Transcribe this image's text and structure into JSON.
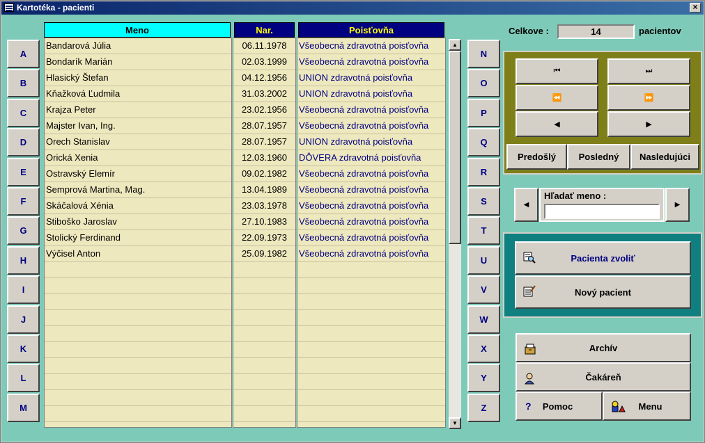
{
  "window": {
    "title": "Kartotéka - pacienti",
    "close": "×"
  },
  "letters_left": [
    "A",
    "B",
    "C",
    "D",
    "E",
    "F",
    "G",
    "H",
    "I",
    "J",
    "K",
    "L",
    "M"
  ],
  "letters_right": [
    "N",
    "O",
    "P",
    "Q",
    "R",
    "S",
    "T",
    "U",
    "V",
    "W",
    "X",
    "Y",
    "Z"
  ],
  "table": {
    "headers": {
      "name": "Meno",
      "date": "Nar.",
      "insurer": "Poisťovňa"
    },
    "header_colors": {
      "name_bg": "#00ffff",
      "other_bg": "#000080",
      "other_fg": "#ffff00"
    },
    "rows": [
      {
        "name": "Bandarová Júlia",
        "date": "06.11.1978",
        "insurer": "Všeobecná zdravotná poisťovňa"
      },
      {
        "name": "Bondarík Marián",
        "date": "02.03.1999",
        "insurer": "Všeobecná zdravotná poisťovňa"
      },
      {
        "name": "Hlasický Štefan",
        "date": "04.12.1956",
        "insurer": "UNION zdravotná poisťovňa"
      },
      {
        "name": "Kňažková Ľudmila",
        "date": "31.03.2002",
        "insurer": "UNION zdravotná poisťovňa"
      },
      {
        "name": "Krajza Peter",
        "date": "23.02.1956",
        "insurer": "Všeobecná zdravotná poisťovňa"
      },
      {
        "name": "Majster Ivan, Ing.",
        "date": "28.07.1957",
        "insurer": "Všeobecná zdravotná poisťovňa"
      },
      {
        "name": "Orech Stanislav",
        "date": "28.07.1957",
        "insurer": "UNION zdravotná poisťovňa"
      },
      {
        "name": "Orická Xenia",
        "date": "12.03.1960",
        "insurer": "DÔVERA zdravotná poisťovňa"
      },
      {
        "name": "Ostravský Elemír",
        "date": "09.02.1982",
        "insurer": "Všeobecná zdravotná poisťovňa"
      },
      {
        "name": "Semprová Martina, Mag.",
        "date": "13.04.1989",
        "insurer": "Všeobecná zdravotná poisťovňa"
      },
      {
        "name": "Skáčalová Xénia",
        "date": "23.03.1978",
        "insurer": "Všeobecná zdravotná poisťovňa"
      },
      {
        "name": "Stiboško Jaroslav",
        "date": "27.10.1983",
        "insurer": "Všeobecná zdravotná poisťovňa"
      },
      {
        "name": "Stolický Ferdinand",
        "date": "22.09.1973",
        "insurer": "Všeobecná zdravotná poisťovňa"
      },
      {
        "name": "Výčisel Anton",
        "date": "25.09.1982",
        "insurer": "Všeobecná zdravotná poisťovňa"
      }
    ]
  },
  "summary": {
    "label": "Celkove :",
    "count": "14",
    "suffix": "pacientov"
  },
  "nav": {
    "first": "⏮",
    "last": "⏭",
    "prev_page": "⏪",
    "next_page": "⏩",
    "prev": "◀",
    "next": "▶",
    "prev_label": "Predošlý",
    "last_label": "Posledný",
    "next_label": "Nasledujúci"
  },
  "search": {
    "label": "Hľadať meno :",
    "value": "",
    "prev": "◀",
    "next": "▶"
  },
  "actions": {
    "select_patient": "Pacienta zvoliť",
    "new_patient": "Nový pacient"
  },
  "bottom": {
    "archive": "Archív",
    "waiting_room": "Čakáreň",
    "help": "Pomoc",
    "help_icon": "?",
    "menu": "Menu"
  },
  "scrollbar": {
    "up": "▲",
    "down": "▼"
  }
}
